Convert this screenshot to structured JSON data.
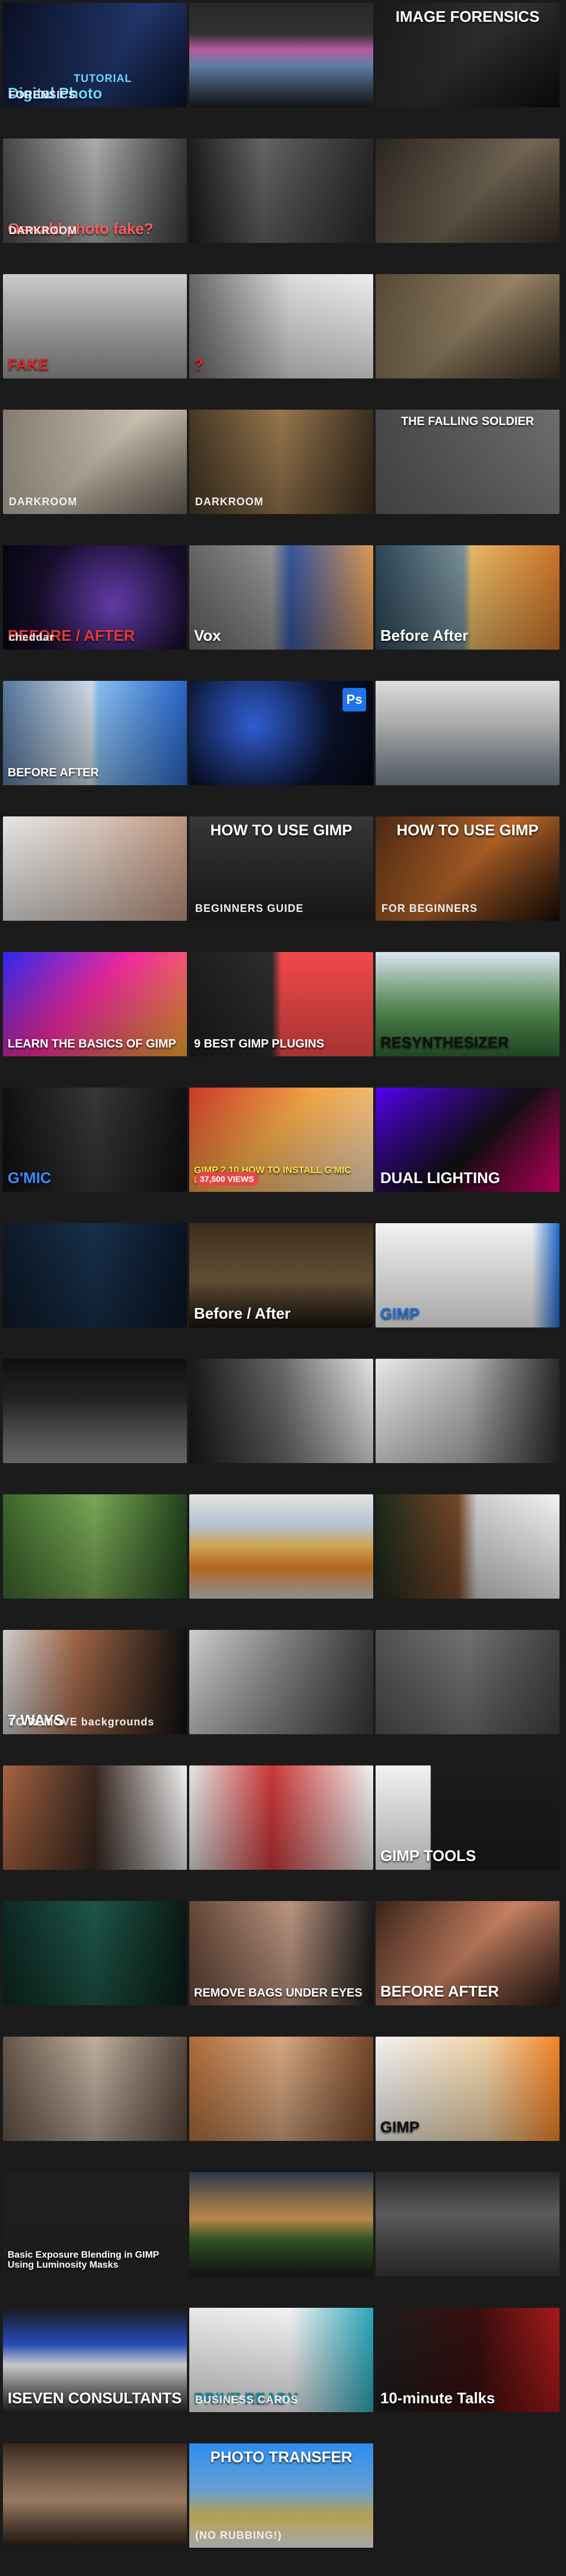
{
  "tiles": [
    {
      "row": 0,
      "col": 0,
      "caption": "Digital Photo",
      "sub": "FORENSICS",
      "tag": "TUTORIAL",
      "bg": "linear-gradient(120deg,#0a0f24,#243a73 60%,#0b1430)",
      "accent": "#6ed4ff"
    },
    {
      "row": 0,
      "col": 1,
      "caption": "",
      "bg": "linear-gradient(180deg,#2a2a2a,#3a3a3a 30%,#e26fc1 45%,#7ca3d6 60%,#1e1e1e)",
      "accent": "#ffffff"
    },
    {
      "row": 0,
      "col": 2,
      "caption": "IMAGE FORENSICS",
      "bg": "linear-gradient(135deg,#1a1a1a,#333 50%,#0e0e0e)",
      "accent": "#ffffff"
    },
    {
      "row": 1,
      "col": 0,
      "caption": "Oswald photo fake?",
      "sub": "DARKROOM",
      "bg": "linear-gradient(90deg,#4a4a4a,#b5b5b5 50%,#3a3a3a)",
      "accent": "#ff5a5a"
    },
    {
      "row": 1,
      "col": 1,
      "caption": "",
      "bg": "linear-gradient(90deg,#1e1e1e,#6a6a6a 40%,#2b2b2b)",
      "accent": "#ffffff"
    },
    {
      "row": 1,
      "col": 2,
      "caption": "",
      "bg": "linear-gradient(135deg,#2b2620,#7a6d5a 55%,#3a2f25)",
      "accent": "#ffffff"
    },
    {
      "row": 2,
      "col": 0,
      "caption": "FAKE",
      "bg": "linear-gradient(180deg,#d7d7d7,#9e9e9e)",
      "accent": "#e42424"
    },
    {
      "row": 2,
      "col": 1,
      "caption": "?",
      "bg": "linear-gradient(90deg,#6e6e6e,#e8e8e8 55%,#fafafa)",
      "accent": "#e42424"
    },
    {
      "row": 2,
      "col": 2,
      "caption": "",
      "bg": "linear-gradient(135deg,#5a4b38,#a08c6c 50%,#3e3224)",
      "accent": "#ffffff"
    },
    {
      "row": 3,
      "col": 0,
      "caption": "",
      "sub": "DARKROOM",
      "bg": "linear-gradient(135deg,#8a8175,#d6cdbb 50%,#6f665a)",
      "accent": "#ffffff"
    },
    {
      "row": 3,
      "col": 1,
      "caption": "",
      "sub": "DARKROOM",
      "bg": "linear-gradient(90deg,#4a3b28,#a07d52 50%,#3d3020)",
      "accent": "#ffffff"
    },
    {
      "row": 3,
      "col": 2,
      "caption": "THE FALLING SOLDIER",
      "bg": "linear-gradient(135deg,#4a4a4a,#8a8a8a)",
      "accent": "#ffffff"
    },
    {
      "row": 4,
      "col": 0,
      "caption": "BEFORE / AFTER",
      "sub": "cheddar",
      "bg": "radial-gradient(circle at 60% 60%,#7d4bd6,#1a1030 60%,#05050f)",
      "accent": "#e03a3a"
    },
    {
      "row": 4,
      "col": 1,
      "caption": "Vox",
      "bg": "linear-gradient(90deg,#6a6a6a,#9a9a9a 45%,#3b5aa6 55%,#e8a25a)",
      "accent": "#ffffff"
    },
    {
      "row": 4,
      "col": 2,
      "caption": "Before    After",
      "bg": "linear-gradient(90deg,#2f4a5a,#7f98a3 48%,#f3c26b 52%,#d77a2a)",
      "accent": "#ffffff"
    },
    {
      "row": 5,
      "col": 0,
      "caption": "BEFORE        AFTER",
      "bg": "linear-gradient(90deg,#5b7ea8,#dbe7f1 48%,#8ec8ff 52%,#2b6ad1)",
      "accent": "#ffffff"
    },
    {
      "row": 5,
      "col": 1,
      "caption": "",
      "badge": "Ps",
      "bg": "radial-gradient(circle at 35% 45%,#3a73ff,#0c1430 60%,#050814)",
      "accent": "#3aa0ff"
    },
    {
      "row": 5,
      "col": 2,
      "caption": "",
      "bg": "linear-gradient(180deg,#e9e9e9,#cfcfcf 40%,#7d8a99)",
      "accent": "#ffffff"
    },
    {
      "row": 6,
      "col": 0,
      "caption": "",
      "bg": "linear-gradient(90deg,#f2f2f2,#e4d2c6 50%,#c89c86)",
      "accent": "#111111"
    },
    {
      "row": 6,
      "col": 1,
      "caption": "HOW TO USE GIMP",
      "sub": "BEGINNERS GUIDE",
      "bg": "linear-gradient(180deg,#3b3b3b,#222)",
      "accent": "#ffffff"
    },
    {
      "row": 6,
      "col": 2,
      "caption": "HOW TO USE GIMP",
      "sub": "FOR BEGINNERS",
      "bg": "linear-gradient(135deg,#4c2a14,#c26b2b 50%,#1b0f08)",
      "accent": "#ffffff"
    },
    {
      "row": 7,
      "col": 0,
      "caption": "LEARN THE BASICS OF GIMP",
      "bg": "linear-gradient(135deg,#2c2cff,#ff2ca8 45%,#ffb02c)",
      "accent": "#ffffff"
    },
    {
      "row": 7,
      "col": 1,
      "caption": "9 BEST GIMP PLUGINS",
      "bg": "linear-gradient(90deg,#1f1f1f,#2f2f2f 45%,#ff4d4d 50%,#ff4d4d)",
      "accent": "#ffffff"
    },
    {
      "row": 7,
      "col": 2,
      "caption": "RESYNTHESIZER",
      "bg": "linear-gradient(180deg,#e7f3ff,#5fa15a 60%,#2f6b36)",
      "accent": "#111111"
    },
    {
      "row": 8,
      "col": 0,
      "caption": "G'MIC",
      "bg": "linear-gradient(90deg,#111,#3a3a3a 50%,#111)",
      "accent": "#3a8cff"
    },
    {
      "row": 8,
      "col": 1,
      "caption": "GIMP 2.10 HOW TO INSTALL G'MIC PLUGIN",
      "pill": "37,500 VIEWS",
      "bg": "linear-gradient(135deg,#d63b2b,#ffb04a 45%,#ffe6c7)",
      "accent": "#ffe14a"
    },
    {
      "row": 8,
      "col": 2,
      "caption": "DUAL LIGHTING",
      "bg": "linear-gradient(135deg,#5a00ff,#111 55%,#ff0080)",
      "accent": "#ffffff"
    },
    {
      "row": 9,
      "col": 0,
      "caption": "",
      "bg": "linear-gradient(90deg,#0f1a2a,#18324f 50%,#0a1424)",
      "accent": "#ff4fd8"
    },
    {
      "row": 9,
      "col": 1,
      "caption": "Before / After",
      "bg": "linear-gradient(180deg,#3d2f1f,#7b6242 55%,#1a140e)",
      "accent": "#ffffff"
    },
    {
      "row": 9,
      "col": 2,
      "caption": "GIMP",
      "bg": "linear-gradient(90deg,#ffffff,#ffffff 85%,#1e6ed8)",
      "accent": "#1e6ed8"
    },
    {
      "row": 10,
      "col": 0,
      "caption": "",
      "bg": "linear-gradient(180deg,#101010,#2a2a2a 40%,#9a9a9a)",
      "accent": "#ffffff"
    },
    {
      "row": 10,
      "col": 1,
      "caption": "",
      "bg": "linear-gradient(90deg,#1a1a1a,#6e6e6e 50%,#f0f0f0)",
      "accent": "#ffffff"
    },
    {
      "row": 10,
      "col": 2,
      "caption": "",
      "bg": "linear-gradient(90deg,#f5f5f5,#bdbdbd 50%,#2d2d2d)",
      "accent": "#111111"
    },
    {
      "row": 11,
      "col": 0,
      "caption": "",
      "bg": "linear-gradient(90deg,#3f6a2e,#7fb05a 50%,#23461d)",
      "accent": "#ffffff"
    },
    {
      "row": 11,
      "col": 1,
      "caption": "",
      "bg": "linear-gradient(180deg,#f0f0f0,#cfe0f3 30%,#ffcc66 50%,#f28a2a 70%,#d9d9d9)",
      "accent": "#ffffff"
    },
    {
      "row": 11,
      "col": 2,
      "caption": "",
      "bg": "linear-gradient(90deg,#1e2b1e,#7b4b2a 45%,#d9d9d9 55%,#ffffff)",
      "accent": "#ffffff"
    },
    {
      "row": 12,
      "col": 0,
      "caption": "7 WAYS",
      "sub": "TO REMOVE backgrounds",
      "bg": "linear-gradient(90deg,#d9d9d9,#a86a4a 40%,#111)",
      "accent": "#ffffff"
    },
    {
      "row": 12,
      "col": 1,
      "caption": "",
      "bg": "linear-gradient(90deg,#d9d9d9,#8a8a8a 50%,#3b3b3b)",
      "accent": "#ffffff"
    },
    {
      "row": 12,
      "col": 2,
      "caption": "",
      "bg": "linear-gradient(90deg,#555,#777 50%,#444)",
      "accent": "#ffffff"
    },
    {
      "row": 13,
      "col": 0,
      "caption": "",
      "bg": "linear-gradient(90deg,#b26945,#3b2a22 50%,#ffffff)",
      "accent": "#111111"
    },
    {
      "row": 13,
      "col": 1,
      "caption": "",
      "bg": "linear-gradient(90deg,#f2f2f2,#d63b3b 45%,#ffffff)",
      "accent": "#e04848"
    },
    {
      "row": 13,
      "col": 2,
      "caption": "GIMP TOOLS",
      "bg": "linear-gradient(90deg,#ffffff,#ffffff 30%,#1d1d1d 30%)",
      "accent": "#ffffff"
    },
    {
      "row": 14,
      "col": 0,
      "caption": "",
      "bg": "linear-gradient(90deg,#0e2a24,#1f5b4b 50%,#0b1c18)",
      "accent": "#ffffff"
    },
    {
      "row": 14,
      "col": 1,
      "caption": "REMOVE BAGS UNDER EYES",
      "bg": "linear-gradient(90deg,#6a4b3b,#c59c87 55%,#1d1d1d)",
      "accent": "#ffffff"
    },
    {
      "row": 14,
      "col": 2,
      "caption": "BEFORE   AFTER",
      "bg": "linear-gradient(135deg,#3b2318,#d68a6a 50%,#2a1a13)",
      "accent": "#ffffff"
    },
    {
      "row": 15,
      "col": 0,
      "caption": "",
      "bg": "linear-gradient(90deg,#6b5a4d,#c9b7a6 50%,#5a4a3f)",
      "accent": "#ffffff"
    },
    {
      "row": 15,
      "col": 1,
      "caption": "",
      "bg": "linear-gradient(90deg,#b8723d,#e2b18a 50%,#7b4a2a)",
      "accent": "#ffffff"
    },
    {
      "row": 15,
      "col": 2,
      "caption": "GIMP",
      "bg": "linear-gradient(90deg,#ffffff,#ffe0b0 60%,#ff8a2a)",
      "accent": "#111111"
    },
    {
      "row": 16,
      "col": 0,
      "caption": "Basic Exposure Blending in GIMP Using Luminosity Masks",
      "bg": "linear-gradient(180deg,#1f1f1f,#2a2a2a)",
      "accent": "#ffffff"
    },
    {
      "row": 16,
      "col": 1,
      "caption": "",
      "bg": "linear-gradient(180deg,#2d3a4a,#e2a45b 45%,#3f6a2e 65%,#1d1d1d)",
      "accent": "#ffffff"
    },
    {
      "row": 16,
      "col": 2,
      "caption": "",
      "bg": "linear-gradient(180deg,#2a2a2a,#6d6d6d 40%,#3b3b3b)",
      "accent": "#ffffff"
    },
    {
      "row": 17,
      "col": 0,
      "caption": "ISEVEN CONSULTANTS",
      "bg": "linear-gradient(180deg,#1a1a1a,#2c58d6 35%,#ffffff 55%,#2a2a2a)",
      "accent": "#ffffff"
    },
    {
      "row": 17,
      "col": 1,
      "caption": "PRINT-READY",
      "sub": "BUSINESS CARDS",
      "bg": "linear-gradient(90deg,#f4f4f4,#ffffff 55%,#2db0c4)",
      "accent": "#1b8fa3"
    },
    {
      "row": 17,
      "col": 2,
      "caption": "10-minute Talks",
      "bg": "linear-gradient(90deg,#1f1f1f,#3a0f0f 55%,#b31b1b)",
      "accent": "#ffffff"
    },
    {
      "row": 18,
      "col": 0,
      "caption": "",
      "bg": "linear-gradient(180deg,#3b2a1f,#c39b7a 55%,#2a1f18)",
      "accent": "#ffffff"
    },
    {
      "row": 18,
      "col": 1,
      "caption": "PHOTO TRANSFER",
      "sub": "(NO RUBBING!)",
      "bg": "linear-gradient(180deg,#2b95ff,#7cc3ff 45%,#f2d86a 70%,#ffffff)",
      "accent": "#ffffff"
    }
  ]
}
